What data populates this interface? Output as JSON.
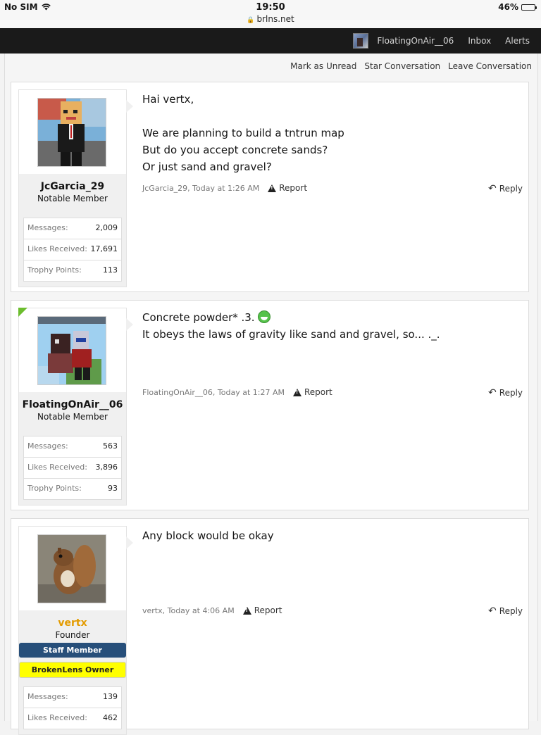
{
  "status_bar": {
    "carrier": "No SIM",
    "time": "19:50",
    "url": "brlns.net",
    "battery": "46%",
    "battery_level": 0.46
  },
  "nav": {
    "username": "FloatingOnAir__06",
    "inbox": "Inbox",
    "alerts": "Alerts"
  },
  "conversation_actions": {
    "mark_unread": "Mark as Unread",
    "star": "Star Conversation",
    "leave": "Leave Conversation"
  },
  "messages": [
    {
      "author": "JcGarcia_29",
      "user_title": "Notable Member",
      "stats": [
        {
          "label": "Messages:",
          "value": "2,009"
        },
        {
          "label": "Likes Received:",
          "value": "17,691"
        },
        {
          "label": "Trophy Points:",
          "value": "113"
        }
      ],
      "lines": [
        "Hai vertx,",
        "",
        "We are planning to build a tntrun map",
        "But do you accept concrete sands?",
        "Or just sand and gravel?"
      ],
      "byline": "JcGarcia_29, Today at 1:26 AM",
      "report": "Report",
      "reply": "Reply"
    },
    {
      "author": "FloatingOnAir__06",
      "user_title": "Notable Member",
      "stats": [
        {
          "label": "Messages:",
          "value": "563"
        },
        {
          "label": "Likes Received:",
          "value": "3,896"
        },
        {
          "label": "Trophy Points:",
          "value": "93"
        }
      ],
      "line1": "Concrete powder* .3.",
      "line2": "It obeys the laws of gravity like sand and gravel, so... ._.",
      "byline": "FloatingOnAir__06, Today at 1:27 AM",
      "report": "Report",
      "reply": "Reply"
    },
    {
      "author": "vertx",
      "user_title": "Founder",
      "banner_staff": "Staff Member",
      "banner_owner": "BrokenLens Owner",
      "stats": [
        {
          "label": "Messages:",
          "value": "139"
        },
        {
          "label": "Likes Received:",
          "value": "462"
        }
      ],
      "lines": [
        "Any block would be okay"
      ],
      "byline": "vertx, Today at 4:06 AM",
      "report": "Report",
      "reply": "Reply"
    }
  ]
}
